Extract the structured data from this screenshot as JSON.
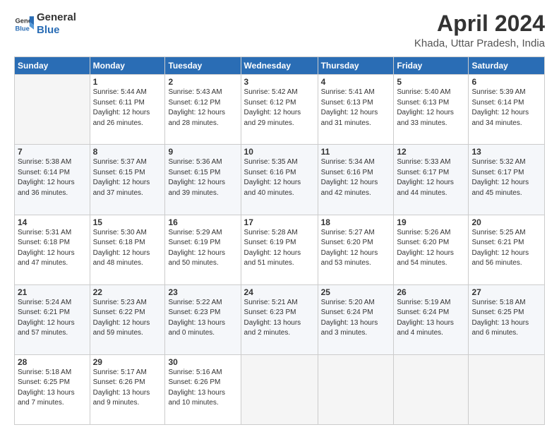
{
  "header": {
    "logo_line1": "General",
    "logo_line2": "Blue",
    "title": "April 2024",
    "subtitle": "Khada, Uttar Pradesh, India"
  },
  "columns": [
    "Sunday",
    "Monday",
    "Tuesday",
    "Wednesday",
    "Thursday",
    "Friday",
    "Saturday"
  ],
  "weeks": [
    [
      {
        "day": "",
        "info": ""
      },
      {
        "day": "1",
        "info": "Sunrise: 5:44 AM\nSunset: 6:11 PM\nDaylight: 12 hours\nand 26 minutes."
      },
      {
        "day": "2",
        "info": "Sunrise: 5:43 AM\nSunset: 6:12 PM\nDaylight: 12 hours\nand 28 minutes."
      },
      {
        "day": "3",
        "info": "Sunrise: 5:42 AM\nSunset: 6:12 PM\nDaylight: 12 hours\nand 29 minutes."
      },
      {
        "day": "4",
        "info": "Sunrise: 5:41 AM\nSunset: 6:13 PM\nDaylight: 12 hours\nand 31 minutes."
      },
      {
        "day": "5",
        "info": "Sunrise: 5:40 AM\nSunset: 6:13 PM\nDaylight: 12 hours\nand 33 minutes."
      },
      {
        "day": "6",
        "info": "Sunrise: 5:39 AM\nSunset: 6:14 PM\nDaylight: 12 hours\nand 34 minutes."
      }
    ],
    [
      {
        "day": "7",
        "info": "Sunrise: 5:38 AM\nSunset: 6:14 PM\nDaylight: 12 hours\nand 36 minutes."
      },
      {
        "day": "8",
        "info": "Sunrise: 5:37 AM\nSunset: 6:15 PM\nDaylight: 12 hours\nand 37 minutes."
      },
      {
        "day": "9",
        "info": "Sunrise: 5:36 AM\nSunset: 6:15 PM\nDaylight: 12 hours\nand 39 minutes."
      },
      {
        "day": "10",
        "info": "Sunrise: 5:35 AM\nSunset: 6:16 PM\nDaylight: 12 hours\nand 40 minutes."
      },
      {
        "day": "11",
        "info": "Sunrise: 5:34 AM\nSunset: 6:16 PM\nDaylight: 12 hours\nand 42 minutes."
      },
      {
        "day": "12",
        "info": "Sunrise: 5:33 AM\nSunset: 6:17 PM\nDaylight: 12 hours\nand 44 minutes."
      },
      {
        "day": "13",
        "info": "Sunrise: 5:32 AM\nSunset: 6:17 PM\nDaylight: 12 hours\nand 45 minutes."
      }
    ],
    [
      {
        "day": "14",
        "info": "Sunrise: 5:31 AM\nSunset: 6:18 PM\nDaylight: 12 hours\nand 47 minutes."
      },
      {
        "day": "15",
        "info": "Sunrise: 5:30 AM\nSunset: 6:18 PM\nDaylight: 12 hours\nand 48 minutes."
      },
      {
        "day": "16",
        "info": "Sunrise: 5:29 AM\nSunset: 6:19 PM\nDaylight: 12 hours\nand 50 minutes."
      },
      {
        "day": "17",
        "info": "Sunrise: 5:28 AM\nSunset: 6:19 PM\nDaylight: 12 hours\nand 51 minutes."
      },
      {
        "day": "18",
        "info": "Sunrise: 5:27 AM\nSunset: 6:20 PM\nDaylight: 12 hours\nand 53 minutes."
      },
      {
        "day": "19",
        "info": "Sunrise: 5:26 AM\nSunset: 6:20 PM\nDaylight: 12 hours\nand 54 minutes."
      },
      {
        "day": "20",
        "info": "Sunrise: 5:25 AM\nSunset: 6:21 PM\nDaylight: 12 hours\nand 56 minutes."
      }
    ],
    [
      {
        "day": "21",
        "info": "Sunrise: 5:24 AM\nSunset: 6:21 PM\nDaylight: 12 hours\nand 57 minutes."
      },
      {
        "day": "22",
        "info": "Sunrise: 5:23 AM\nSunset: 6:22 PM\nDaylight: 12 hours\nand 59 minutes."
      },
      {
        "day": "23",
        "info": "Sunrise: 5:22 AM\nSunset: 6:23 PM\nDaylight: 13 hours\nand 0 minutes."
      },
      {
        "day": "24",
        "info": "Sunrise: 5:21 AM\nSunset: 6:23 PM\nDaylight: 13 hours\nand 2 minutes."
      },
      {
        "day": "25",
        "info": "Sunrise: 5:20 AM\nSunset: 6:24 PM\nDaylight: 13 hours\nand 3 minutes."
      },
      {
        "day": "26",
        "info": "Sunrise: 5:19 AM\nSunset: 6:24 PM\nDaylight: 13 hours\nand 4 minutes."
      },
      {
        "day": "27",
        "info": "Sunrise: 5:18 AM\nSunset: 6:25 PM\nDaylight: 13 hours\nand 6 minutes."
      }
    ],
    [
      {
        "day": "28",
        "info": "Sunrise: 5:18 AM\nSunset: 6:25 PM\nDaylight: 13 hours\nand 7 minutes."
      },
      {
        "day": "29",
        "info": "Sunrise: 5:17 AM\nSunset: 6:26 PM\nDaylight: 13 hours\nand 9 minutes."
      },
      {
        "day": "30",
        "info": "Sunrise: 5:16 AM\nSunset: 6:26 PM\nDaylight: 13 hours\nand 10 minutes."
      },
      {
        "day": "",
        "info": ""
      },
      {
        "day": "",
        "info": ""
      },
      {
        "day": "",
        "info": ""
      },
      {
        "day": "",
        "info": ""
      }
    ]
  ]
}
